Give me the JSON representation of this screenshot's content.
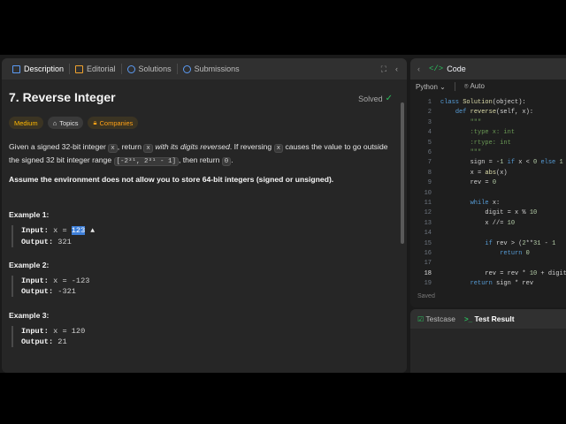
{
  "tabs": [
    {
      "label": "Description",
      "icon": "document-icon",
      "active": true
    },
    {
      "label": "Editorial",
      "icon": "book-icon",
      "active": false
    },
    {
      "label": "Solutions",
      "icon": "flask-icon",
      "active": false
    },
    {
      "label": "Submissions",
      "icon": "history-icon",
      "active": false
    }
  ],
  "problem": {
    "title": "7. Reverse Integer",
    "status": "Solved",
    "tags": [
      "Medium",
      "Topics",
      "Companies"
    ],
    "desc_p1": "Given a signed 32-bit integer",
    "desc_x": "x",
    "desc_p2": ", return",
    "desc_x2": "x",
    "desc_em": "with its digits reversed",
    "desc_p3": ". If reversing",
    "desc_x3": "x",
    "desc_p4": "causes the value to go outside the signed 32 bit integer range",
    "range": "[-2³¹, 2³¹ - 1]",
    "desc_p5": ", then return",
    "zero": "0",
    "desc_p6": ".",
    "assume": "Assume the environment does not allow you to store 64-bit integers (signed or unsigned)."
  },
  "examples": [
    {
      "title": "Example 1:",
      "input_label": "Input:",
      "input_var": "x = ",
      "input_val": "123",
      "output_label": "Output:",
      "output_val": "321"
    },
    {
      "title": "Example 2:",
      "input_label": "Input:",
      "input_var": "x = ",
      "input_val": "-123",
      "output_label": "Output:",
      "output_val": "-321"
    },
    {
      "title": "Example 3:",
      "input_label": "Input:",
      "input_var": "x = ",
      "input_val": "120",
      "output_label": "Output:",
      "output_val": "21"
    }
  ],
  "code_panel": {
    "title": "Code",
    "language": "Python",
    "mode": "Auto",
    "saved": "Saved",
    "lines": [
      {
        "n": "1",
        "text": "class Solution(object):"
      },
      {
        "n": "2",
        "text": "    def reverse(self, x):"
      },
      {
        "n": "3",
        "text": "        \"\"\""
      },
      {
        "n": "4",
        "text": "        :type x: int"
      },
      {
        "n": "5",
        "text": "        :rtype: int"
      },
      {
        "n": "6",
        "text": "        \"\"\""
      },
      {
        "n": "7",
        "text": "        sign = -1 if x < 0 else 1"
      },
      {
        "n": "8",
        "text": "        x = abs(x)"
      },
      {
        "n": "9",
        "text": "        rev = 0"
      },
      {
        "n": "10",
        "text": ""
      },
      {
        "n": "11",
        "text": "        while x:"
      },
      {
        "n": "12",
        "text": "            digit = x % 10"
      },
      {
        "n": "13",
        "text": "            x //= 10"
      },
      {
        "n": "14",
        "text": ""
      },
      {
        "n": "15",
        "text": "            if rev > (2**31 - 1"
      },
      {
        "n": "16",
        "text": "                return 0"
      },
      {
        "n": "17",
        "text": ""
      },
      {
        "n": "18",
        "text": "            rev = rev * 10 + digit"
      },
      {
        "n": "19",
        "text": "        return sign * rev"
      }
    ]
  },
  "bottom_panel": {
    "tab1": "Testcase",
    "tab2": "Test Result"
  }
}
